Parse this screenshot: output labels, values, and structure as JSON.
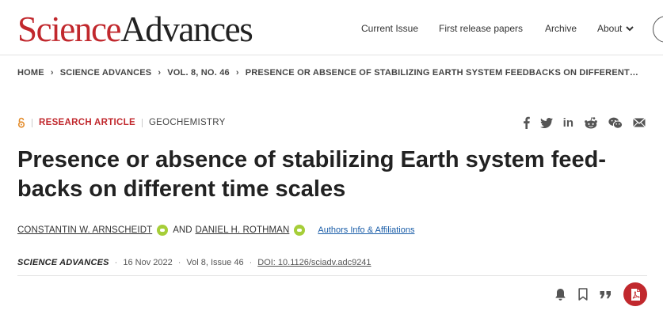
{
  "logo": {
    "part1": "Science",
    "part2": "Advances"
  },
  "nav": {
    "items": [
      {
        "label": "Current Issue"
      },
      {
        "label": "First release papers"
      },
      {
        "label": "Archive"
      },
      {
        "label": "About"
      }
    ]
  },
  "breadcrumb": [
    "HOME",
    "SCIENCE ADVANCES",
    "VOL. 8, NO. 46",
    "PRESENCE OR ABSENCE OF STABILIZING EARTH SYSTEM FEEDBACKS ON DIFFERENT…"
  ],
  "article": {
    "type": "RESEARCH ARTICLE",
    "subject": "GEOCHEMISTRY",
    "title": "Presence or absence of stabilizing Earth system feed-backs on different time scales",
    "authors": [
      "CONSTANTIN W. ARNSCHEIDT",
      "DANIEL H. ROTHMAN"
    ],
    "and_text": "AND",
    "affiliations_link": "Authors Info & Affiliations",
    "journal": "SCIENCE ADVANCES",
    "date": "16 Nov 2022",
    "volume": "Vol 8, Issue 46",
    "doi": "DOI: 10.1126/sciadv.adc9241"
  },
  "share_icons": [
    "facebook-icon",
    "twitter-icon",
    "linkedin-icon",
    "reddit-icon",
    "wechat-icon",
    "email-icon"
  ],
  "action_icons": [
    "alert-bell-icon",
    "bookmark-icon",
    "cite-quote-icon",
    "pdf-icon"
  ],
  "colors": {
    "brand_red": "#c1282d",
    "orcid_green": "#a6ce39",
    "link_blue": "#1a5da8"
  }
}
